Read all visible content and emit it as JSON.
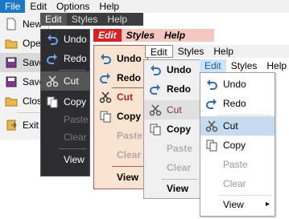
{
  "layer1": {
    "menubar": [
      "File",
      "Edit",
      "Options",
      "Help"
    ],
    "items": [
      "New",
      "Open",
      "Save",
      "Save As",
      "Close",
      "Exit"
    ]
  },
  "layer2": {
    "menubar": [
      "Edit",
      "Styles",
      "Help"
    ],
    "items": [
      "Undo",
      "Redo",
      "Cut",
      "Copy",
      "Paste",
      "Clear",
      "View"
    ]
  },
  "layer3": {
    "menubar": [
      "Edit",
      "Styles",
      "Help"
    ],
    "items": [
      "Undo",
      "Redo",
      "Cut",
      "Copy",
      "Paste",
      "Clear",
      "View"
    ]
  },
  "layer4": {
    "menubar": [
      "Edit",
      "Styles",
      "Help"
    ],
    "items": [
      "Undo",
      "Redo",
      "Cut",
      "Copy",
      "Paste",
      "Clear",
      "View"
    ]
  },
  "layer5": {
    "menubar": [
      "Edit",
      "Styles",
      "Help"
    ],
    "items": [
      "Undo",
      "Redo",
      "Cut",
      "Copy",
      "Paste",
      "Clear",
      "View"
    ],
    "submenu_arrow": "▸"
  },
  "colors": {
    "file_selected": "#1979ca",
    "dark_bg": "#2d2d30",
    "pink_bg": "#f7e3cf",
    "modern_highlight": "#c6dbf0"
  },
  "icons": [
    "undo-icon",
    "redo-icon",
    "cut-icon",
    "copy-icon"
  ]
}
